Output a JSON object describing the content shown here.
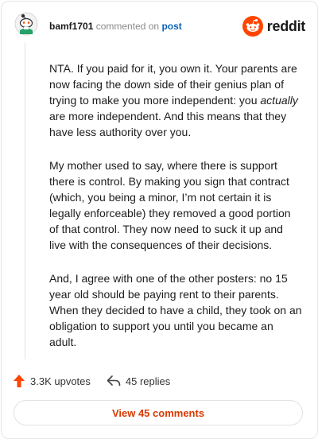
{
  "header": {
    "username": "bamf1701",
    "commented_on": "commented on",
    "post_link": "post",
    "logo_text": "reddit",
    "avatar_icon": "snoo-avatar-icon",
    "logo_icon": "reddit-logo-icon",
    "brand_color": "#ff4500",
    "link_color": "#0d63b5"
  },
  "comment": {
    "p1_a": "NTA. If you paid for it, you own it. Your parents are now facing the down side of their genius plan of trying to make you more independent: you ",
    "p1_em": "actually",
    "p1_b": " are more independent. And this means that they have less authority over you.",
    "p2": "My mother used to say, where there is support there is control. By making you sign that contract (which, you being a minor, I’m not certain it is legally enforceable) they removed a good portion of that control. They now need to suck it up and live with the consequences of their decisions.",
    "p3": "And, I agree with one of the other posters: no 15 year old should be paying rent to their parents. When they decided to have a child, they took on an obligation to support you until you became an adult."
  },
  "actions": {
    "upvotes": "3.3K upvotes",
    "replies": "45 replies",
    "upvote_icon": "upvote-arrow-icon",
    "reply_icon": "reply-arrow-icon",
    "upvote_color": "#ff4500"
  },
  "footer": {
    "view_comments": "View 45 comments",
    "button_color": "#d93a00"
  }
}
